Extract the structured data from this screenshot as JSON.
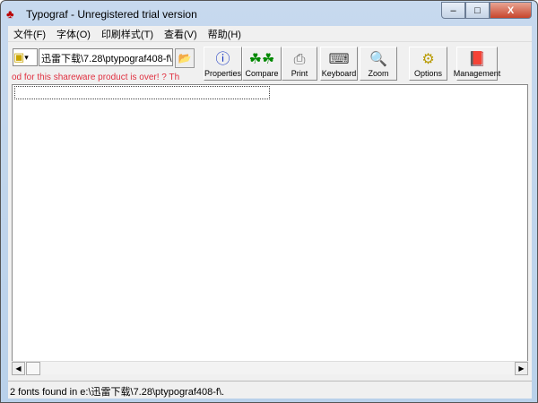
{
  "window": {
    "title": "Typograf - Unregistered trial version",
    "minimize": "–",
    "maximize": "□",
    "close": "X"
  },
  "menu": [
    "文件(F)",
    "字体(O)",
    "印刷样式(T)",
    "查看(V)",
    "帮助(H)"
  ],
  "toolbar": {
    "path": "迅雷下载\\7.28\\ptypograf408-f\\",
    "message": "od for this shareware product is over!    ?   Th",
    "buttons": [
      {
        "label": "Properties",
        "icon": "info-icon"
      },
      {
        "label": "Compare",
        "icon": "compare-icon"
      },
      {
        "label": "Print",
        "icon": "printer-icon"
      },
      {
        "label": "Keyboard",
        "icon": "keyboard-icon"
      },
      {
        "label": "Zoom",
        "icon": "zoom-icon"
      },
      {
        "label": "Options",
        "icon": "options-icon"
      },
      {
        "label": "Management",
        "icon": "book-icon"
      }
    ]
  },
  "status": "2 fonts found in e:\\迅雷下载\\7.28\\ptypograf408-f\\."
}
